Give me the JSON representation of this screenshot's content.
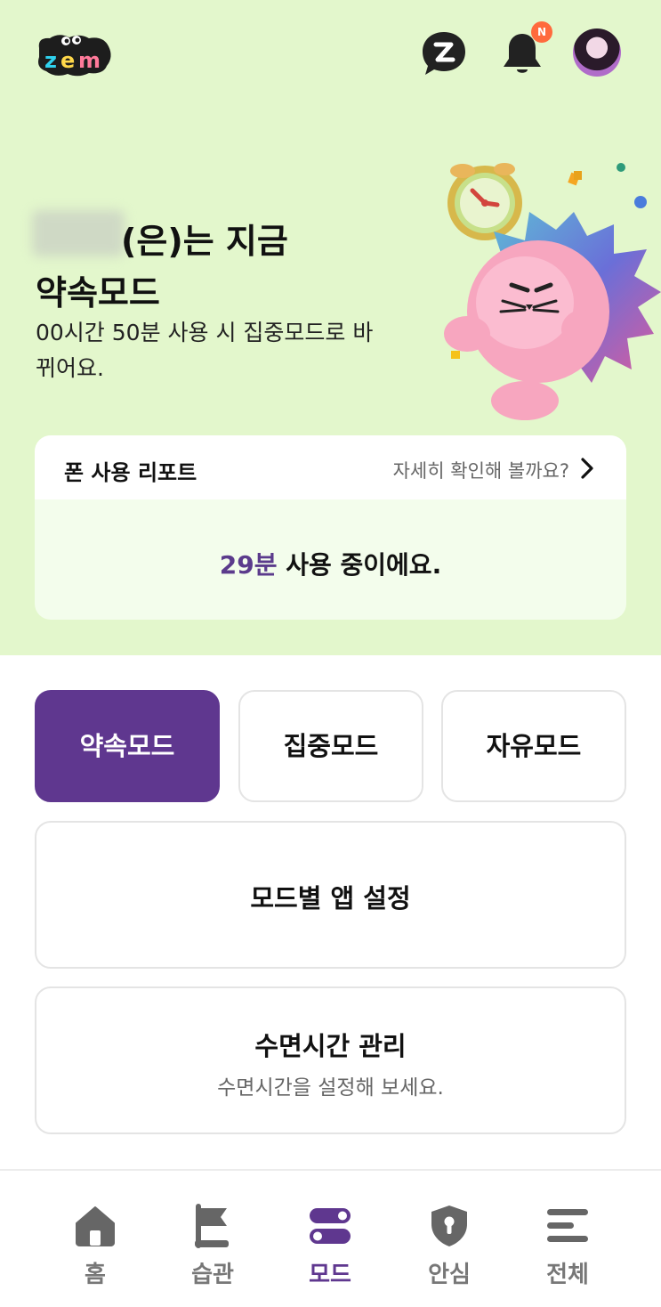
{
  "header": {
    "logo_text": "zem",
    "notification_badge": "N"
  },
  "hero": {
    "line1_suffix": "(은)는 지금",
    "mode_title": "약속모드",
    "description": "00시간 50분 사용 시 집중모드로 바뀌어요."
  },
  "report": {
    "title": "폰 사용 리포트",
    "link_label": "자세히 확인해 볼까요?",
    "usage_value": "29분",
    "usage_suffix": " 사용 중이에요."
  },
  "modes": {
    "items": [
      {
        "label": "약속모드",
        "active": true
      },
      {
        "label": "집중모드",
        "active": false
      },
      {
        "label": "자유모드",
        "active": false
      }
    ]
  },
  "cards": {
    "app_settings_title": "모드별 앱 설정",
    "sleep_title": "수면시간 관리",
    "sleep_subtitle": "수면시간을 설정해 보세요."
  },
  "nav": {
    "items": [
      {
        "label": "홈",
        "icon": "home-icon"
      },
      {
        "label": "습관",
        "icon": "flag-icon"
      },
      {
        "label": "모드",
        "icon": "toggle-icon"
      },
      {
        "label": "안심",
        "icon": "shield-icon"
      },
      {
        "label": "전체",
        "icon": "menu-icon"
      }
    ],
    "active_index": 2
  },
  "colors": {
    "hero_bg": "#e3f7cc",
    "accent_purple": "#5f378f",
    "badge_orange": "#ff6a3d"
  }
}
